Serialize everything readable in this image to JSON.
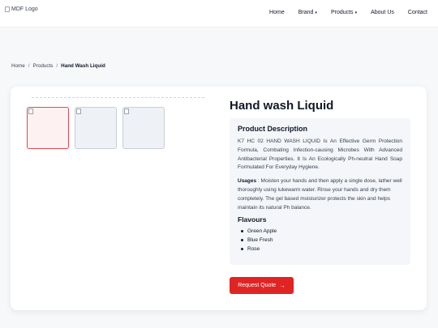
{
  "header": {
    "logo_alt": "MDF Logo",
    "nav": [
      {
        "label": "Home",
        "dropdown": false
      },
      {
        "label": "Brand",
        "dropdown": true
      },
      {
        "label": "Products",
        "dropdown": true
      },
      {
        "label": "About Us",
        "dropdown": false
      },
      {
        "label": "Contact",
        "dropdown": false
      }
    ]
  },
  "breadcrumb": {
    "items": [
      "Home",
      "Products",
      "Hand Wash Liquid"
    ],
    "separator": "/"
  },
  "product": {
    "title": "Hand wash Liquid",
    "description_heading": "Product Description",
    "description": "K7 HC 02 HAND WASH LIQUID Is An Effective Germ Protection Formula, Combating Infection-causing Microbes With Advanced Antibacterial Properties. It Is An Ecologically Ph-neutral Hand Soap Formulated For Everyday Hygiene.",
    "usage_label": "Usages",
    "usage_text": ": Moisten your hands and then apply a single dose, lather well thoroughly using lukewarm water. Rinse your hands and dry them completely. The gel based moisturizer protects the skin and helps maintain its natural Ph balance.",
    "flavours_heading": "Flavours",
    "flavours": [
      "Green Apple",
      "Blue Fresh",
      "Rose"
    ],
    "quote_button": "Request Quote",
    "quote_arrow": "→"
  },
  "colors": {
    "accent": "#e02424",
    "active_thumb_border": "#e5484d"
  },
  "icons": {
    "caret": "▾",
    "broken_image": "broken-image-icon"
  }
}
